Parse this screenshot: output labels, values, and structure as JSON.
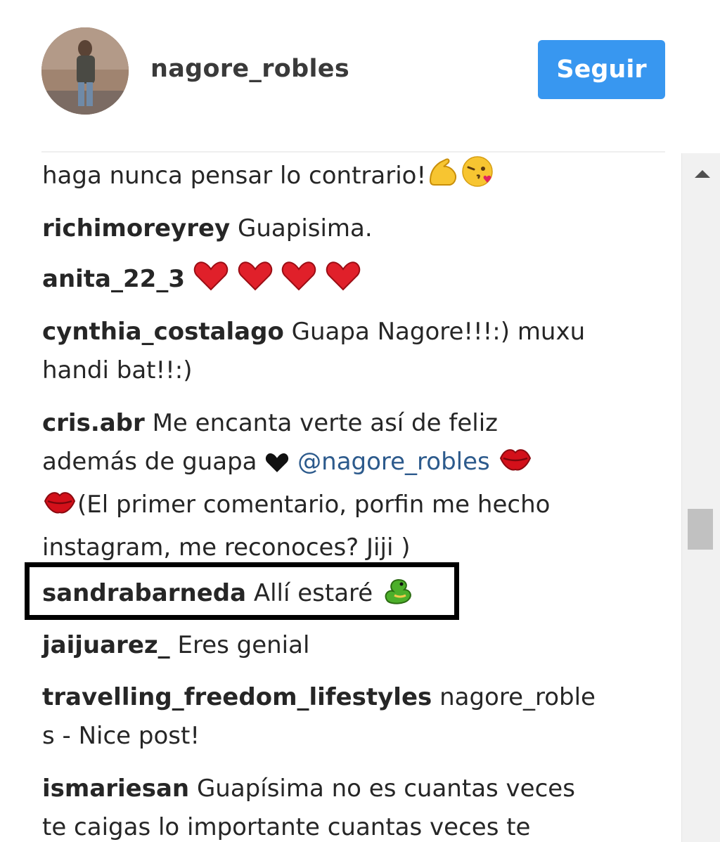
{
  "header": {
    "username": "nagore_robles",
    "follow_label": "Seguir"
  },
  "comments": [
    {
      "user": "",
      "parts": [
        {
          "text": "haga nunca pensar lo contrario!"
        }
      ],
      "emojis": [
        "flexed-biceps-emoji",
        "face-blowing-kiss-emoji"
      ]
    },
    {
      "user": "richimoreyrey",
      "parts": [
        {
          "text": "Guapisima."
        }
      ]
    },
    {
      "user": "anita_22_3",
      "parts": [
        {
          "text": ""
        }
      ],
      "emojis": [
        "red-heart-emoji",
        "red-heart-emoji",
        "red-heart-emoji",
        "red-heart-emoji"
      ]
    },
    {
      "user": "cynthia_costalago",
      "text_line1": "Guapa Nagore!!!:) muxu",
      "text_line2": "handi bat!!:)"
    },
    {
      "user": "cris.abr",
      "text_line1": "Me encanta verte así de feliz",
      "text_line2a": "además de guapa",
      "mention": "@nagore_robles",
      "text_line3": "(El primer comentario, porfin me hecho",
      "text_line4": "instagram, me reconoces? Jiji )"
    },
    {
      "user": "sandrabarneda",
      "text": "Allí estaré"
    },
    {
      "user": "jaijuarez_",
      "text": "Eres genial"
    },
    {
      "user": "travelling_freedom_lifestyles",
      "text_line1": "nagore_roble",
      "text_line2": "s - Nice post!"
    },
    {
      "user": "ismariesan",
      "text_line1": "Guapísima no es cuantas veces",
      "text_line2": "te caigas lo importante cuantas veces te"
    }
  ],
  "colors": {
    "follow_button": "#3897f0",
    "mention": "#2c5a8c",
    "text": "#262626"
  }
}
